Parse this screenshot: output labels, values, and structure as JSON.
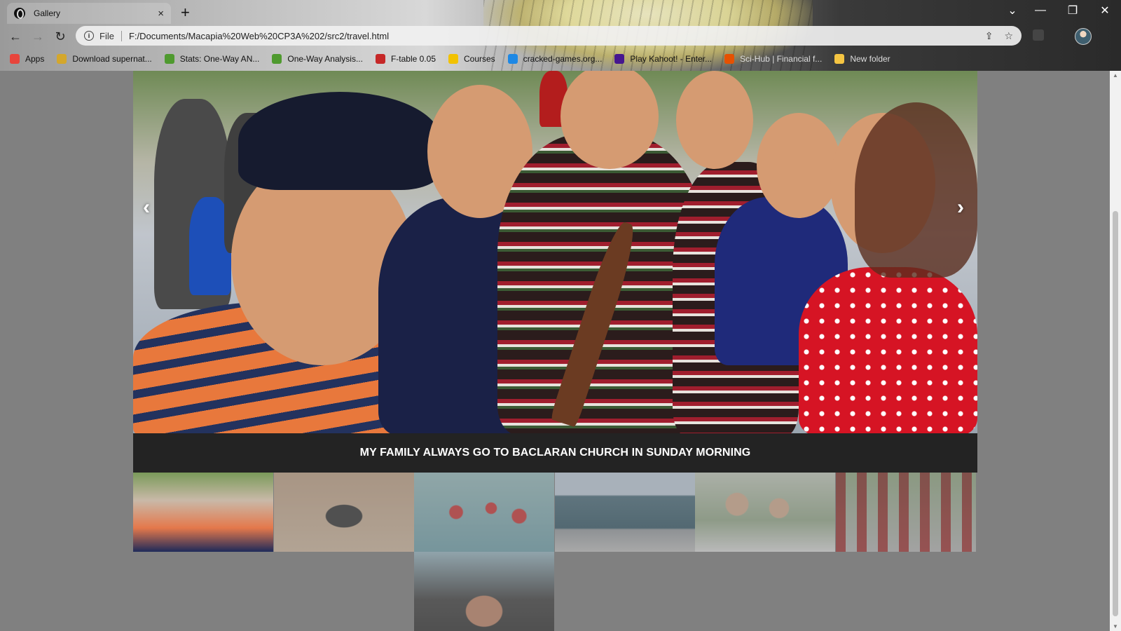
{
  "browser": {
    "tab_title": "Gallery",
    "tab_close": "×",
    "new_tab": "+",
    "url_scheme": "File",
    "url": "F:/Documents/Macapia%20Web%20CP3A%202/src2/travel.html",
    "window_controls": {
      "dropdown": "⌄",
      "minimize": "—",
      "restore": "❐",
      "close": "✕"
    },
    "nav": {
      "back": "←",
      "forward": "→",
      "reload": "↻"
    },
    "omnibox_icons": {
      "share": "⇪",
      "star": "☆"
    }
  },
  "bookmarks": [
    {
      "label": "Apps",
      "icon": "apps-grid-icon",
      "color": "#e8453c"
    },
    {
      "label": "Download supernat...",
      "icon": "download-site-icon",
      "color": "#d4a72c"
    },
    {
      "label": "Stats: One-Way AN...",
      "icon": "stats-leaf-icon",
      "color": "#4f9a2f"
    },
    {
      "label": "One-Way Analysis...",
      "icon": "stats-leaf-icon",
      "color": "#4f9a2f"
    },
    {
      "label": "F-table 0.05",
      "icon": "shield-icon",
      "color": "#c62828"
    },
    {
      "label": "Courses",
      "icon": "course-icon",
      "color": "#f2c200"
    },
    {
      "label": "cracked-games.org...",
      "icon": "download-arrow-icon",
      "color": "#1e88e5"
    },
    {
      "label": "Play Kahoot! - Enter...",
      "icon": "kahoot-icon",
      "color": "#46178f"
    },
    {
      "label": "Sci-Hub | Financial f...",
      "icon": "scihub-icon",
      "color": "#e65100"
    },
    {
      "label": "New folder",
      "icon": "folder-icon",
      "color": "#f5c542"
    }
  ],
  "gallery": {
    "caption": "MY FAMILY ALWAYS GO TO BACLARAN CHURCH IN SUNDAY MORNING",
    "prev": "‹",
    "next": "›",
    "thumbnails": [
      {
        "subject": "family-selfie",
        "active": true
      },
      {
        "subject": "beach-sand-portrait",
        "active": false
      },
      {
        "subject": "swimming-group",
        "active": false
      },
      {
        "subject": "harbor-boats",
        "active": false
      },
      {
        "subject": "group-selfie",
        "active": false
      },
      {
        "subject": "group-photo-outdoors",
        "active": false
      },
      {
        "subject": "holding-hands",
        "active": false
      }
    ]
  },
  "colors": {
    "page_background": "#808080",
    "caption_background": "#232323",
    "caption_text": "#ffffff"
  }
}
